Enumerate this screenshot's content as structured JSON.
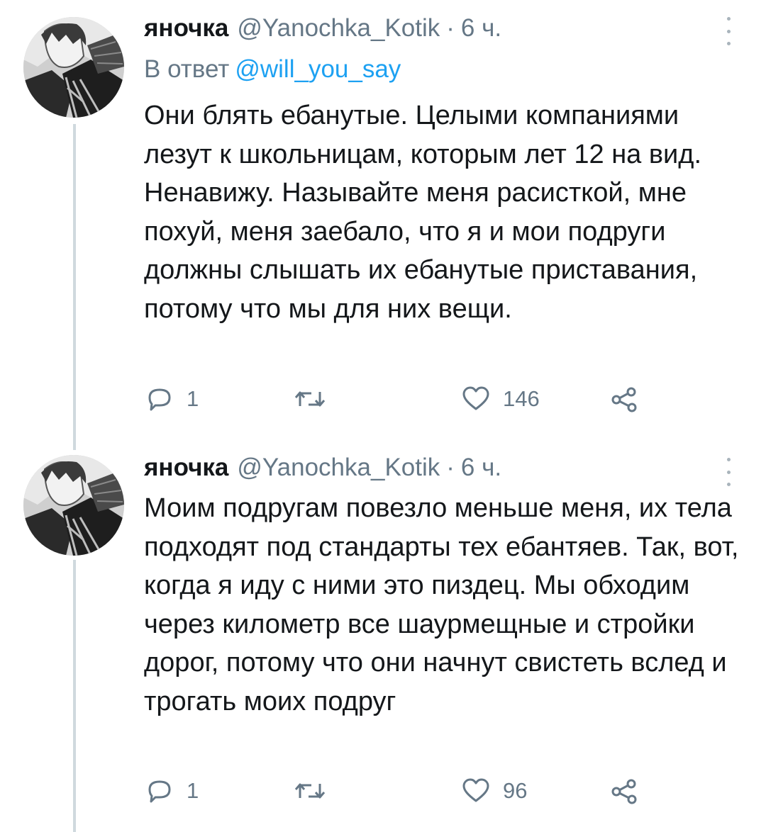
{
  "tweets": [
    {
      "display_name": "яночка",
      "handle": "@Yanochka_Kotik",
      "separator": "·",
      "time": "6 ч.",
      "reply_prefix": "В ответ",
      "reply_mention": "@will_you_say",
      "text": "Они блять ебанутые. Целыми компаниями лезут к школьницам, которым лет 12 на вид. Ненавижу. Называйте меня расисткой, мне похуй, меня заебало, что я и мои подруги должны слышать их ебанутые приставания, потому что мы для них вещи.",
      "reply_count": "1",
      "retweet_count": "",
      "like_count": "146",
      "avatar_icon": "user-avatar",
      "reply_icon": "speech-bubble",
      "retweet_icon": "retweet-arrows",
      "like_icon": "heart",
      "share_icon": "share-nodes",
      "more_icon": "vertical-ellipsis"
    },
    {
      "display_name": "яночка",
      "handle": "@Yanochka_Kotik",
      "separator": "·",
      "time": "6 ч.",
      "text": "Моим подругам повезло меньше меня, их тела подходят под стандарты тех ебантяев. Так, вот, когда я иду с ними это пиздец. Мы обходим через километр все шаурмещные и стройки дорог, потому что они начнут свистеть вслед и трогать моих подруг",
      "reply_count": "1",
      "retweet_count": "",
      "like_count": "96",
      "avatar_icon": "user-avatar",
      "reply_icon": "speech-bubble",
      "retweet_icon": "retweet-arrows",
      "like_icon": "heart",
      "share_icon": "share-nodes",
      "more_icon": "vertical-ellipsis"
    }
  ],
  "colors": {
    "text": "#14171a",
    "secondary": "#657786",
    "mention": "#1da1f2",
    "thread_line": "#cfd9de"
  }
}
